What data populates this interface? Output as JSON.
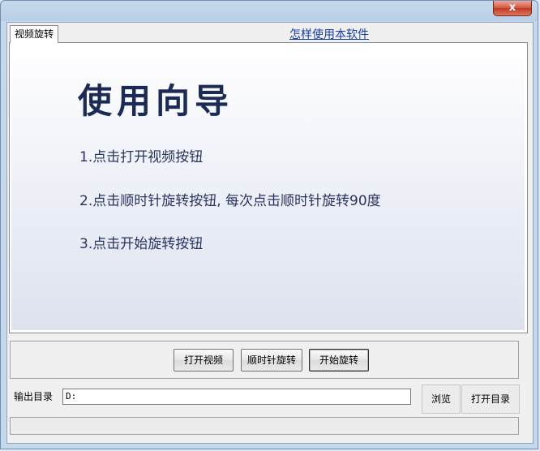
{
  "window": {
    "close_symbol": "x"
  },
  "tabs": [
    {
      "label": "视频旋转",
      "active": true
    }
  ],
  "help_link": "怎样使用本软件",
  "guide": {
    "title": "使用向导",
    "steps": [
      "1.点击打开视频按钮",
      "2.点击顺时针旋转按钮, 每次点击顺时针旋转90度",
      "3.点击开始旋转按钮"
    ]
  },
  "buttons": {
    "open_video": "打开视频",
    "rotate_cw": "顺时针旋转",
    "start_rotate": "开始旋转"
  },
  "output": {
    "label": "输出目录",
    "value": "D:",
    "browse": "浏览",
    "open_dir": "打开目录"
  },
  "colors": {
    "guide_text": "#27345f",
    "link": "#1a3ea8",
    "close": "#c13a22"
  }
}
